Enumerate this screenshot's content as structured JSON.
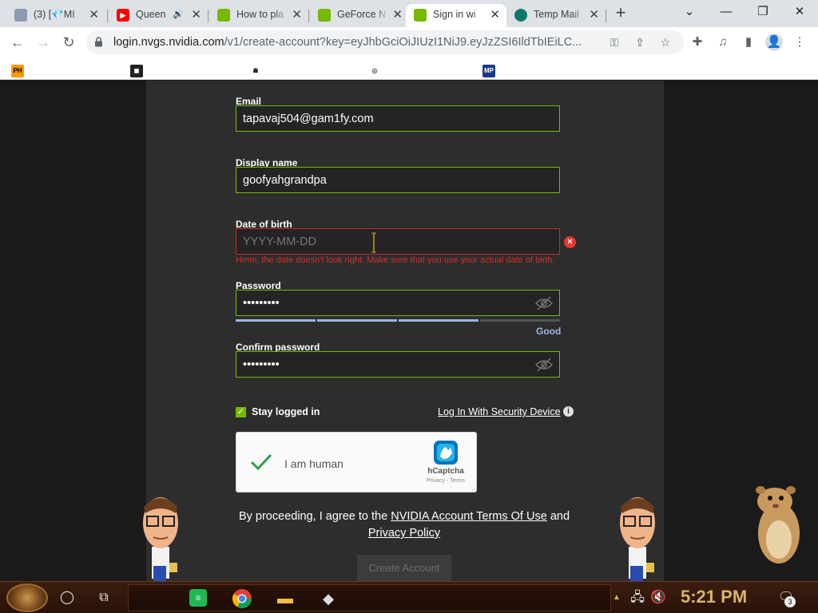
{
  "browser": {
    "tabs": [
      {
        "title": "(3) [💎MI",
        "favicon": "folder-icon",
        "color": "#7a8aa0"
      },
      {
        "title": "Queen",
        "favicon": "youtube-icon",
        "color": "#ff0000"
      },
      {
        "title": "How to pla",
        "favicon": "nvidia-icon",
        "color": "#76b900"
      },
      {
        "title": "GeForce N",
        "favicon": "nvidia-icon",
        "color": "#76b900"
      },
      {
        "title": "Sign in wi",
        "favicon": "nvidia-icon",
        "color": "#76b900",
        "active": true
      },
      {
        "title": "Temp Mail",
        "favicon": "tempmail-icon",
        "color": "#0f7a6b"
      }
    ],
    "url_host": "login.nvgs.nvidia.com",
    "url_path": "/v1/create-account?key=eyJhbGciOiJIUzI1NiJ9.eyJzZSI6IldTbIEiLC...",
    "bookmarks": []
  },
  "form": {
    "email_label": "Email",
    "email_value": "tapavaj504@gam1fy.com",
    "display_label": "Display name",
    "display_value": "goofyahgrandpa",
    "dob_label": "Date of birth",
    "dob_placeholder": "YYYY-MM-DD",
    "dob_error": "Hmm, the date doesn't look right. Make sure that you use your actual date of birth.",
    "password_label": "Password",
    "password_value": "•••••••••",
    "password_strength": "Good",
    "password_strength_level": 0.75,
    "confirm_label": "Confirm password",
    "confirm_value": "•••••••••",
    "stay_logged_in": "Stay logged in",
    "security_device_link": "Log In With Security Device",
    "captcha_text": "I am human",
    "captcha_brand": "hCaptcha",
    "captcha_links": "Privacy - Terms",
    "consent_prefix": "By proceeding, I agree to the",
    "terms_link": "NVIDIA Account Terms Of Use",
    "consent_and": "and",
    "privacy_link": "Privacy Policy",
    "create_button": "Create Account"
  },
  "taskbar": {
    "clock": "5:21 PM",
    "notification_count": "3"
  },
  "colors": {
    "accent": "#76b900",
    "error": "#d32f2f",
    "strength": "#9db7e6"
  }
}
